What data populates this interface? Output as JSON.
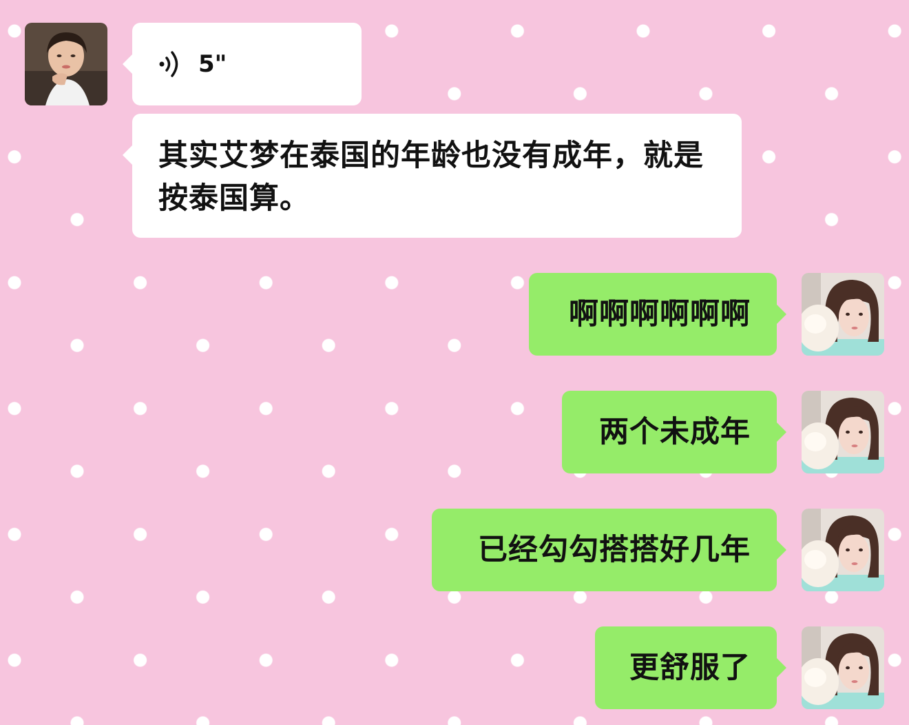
{
  "chat": {
    "messages": [
      {
        "side": "left",
        "type": "voice",
        "duration": "5\""
      },
      {
        "side": "left",
        "type": "text",
        "text": "其实艾梦在泰国的年龄也没有成年，就是按泰国算。"
      },
      {
        "side": "right",
        "type": "text",
        "text": "啊啊啊啊啊啊"
      },
      {
        "side": "right",
        "type": "text",
        "text": "两个未成年"
      },
      {
        "side": "right",
        "type": "text",
        "text": "已经勾勾搭搭好几年"
      },
      {
        "side": "right",
        "type": "text",
        "text": "更舒服了"
      }
    ]
  },
  "colors": {
    "background": "#f7c5de",
    "dots": "#ffffff",
    "incoming_bubble": "#ffffff",
    "outgoing_bubble": "#95ec69"
  },
  "icons": {
    "voice": "voice-wave-icon"
  }
}
